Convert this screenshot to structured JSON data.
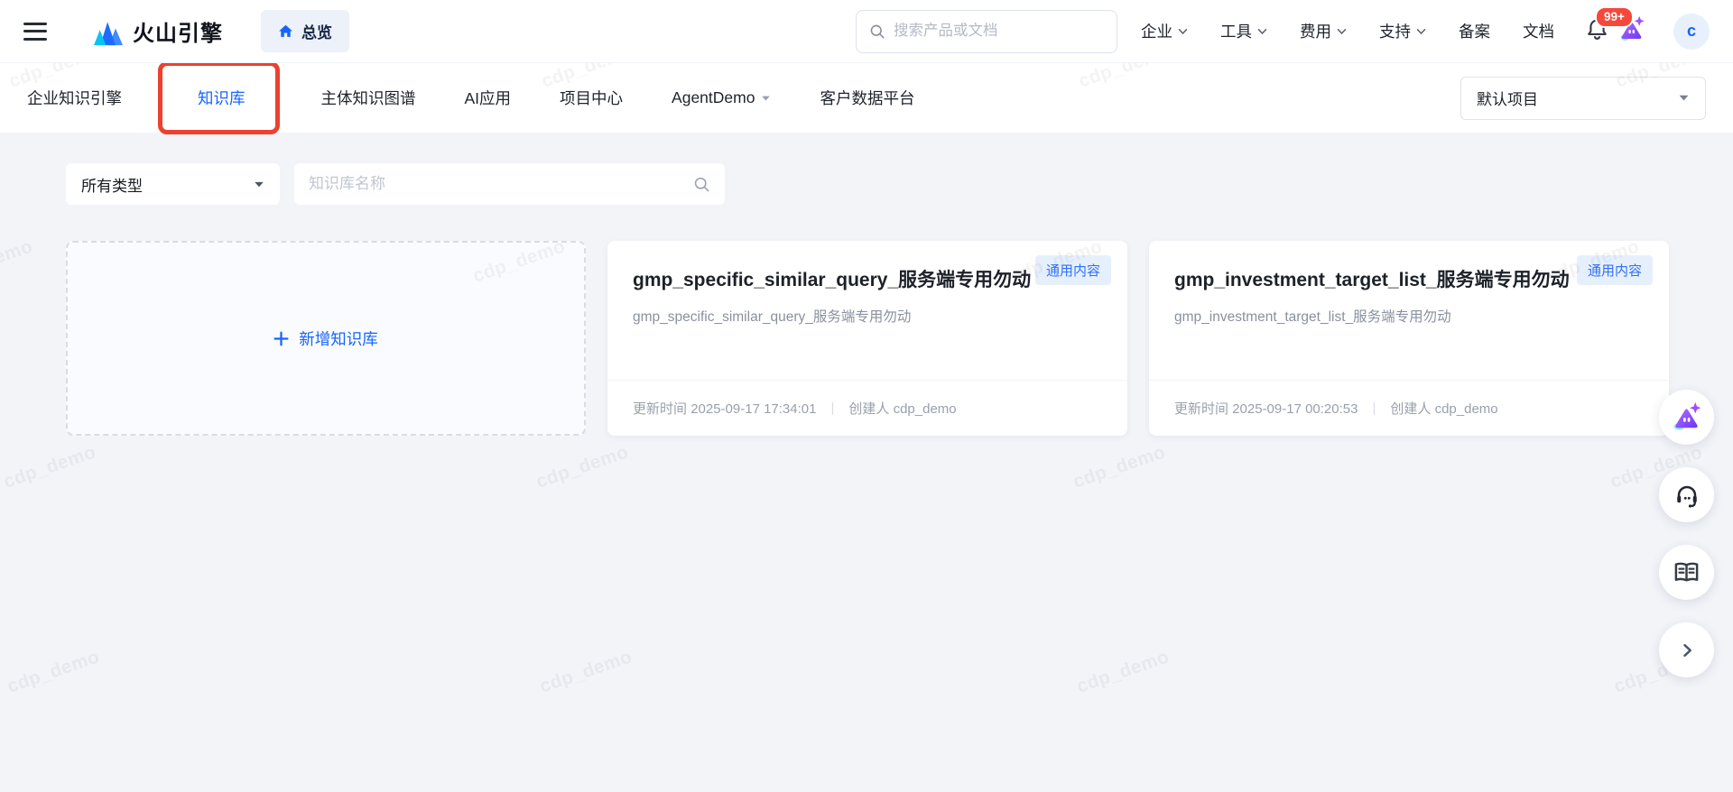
{
  "header": {
    "brand": "火山引擎",
    "overview_label": "总览",
    "search_placeholder": "搜索产品或文档",
    "nav": [
      {
        "label": "企业",
        "dropdown": true
      },
      {
        "label": "工具",
        "dropdown": true
      },
      {
        "label": "费用",
        "dropdown": true
      },
      {
        "label": "支持",
        "dropdown": true
      },
      {
        "label": "备案",
        "dropdown": false
      },
      {
        "label": "文档",
        "dropdown": false
      }
    ],
    "notification_count": "99+",
    "avatar_initial": "c"
  },
  "subnav": {
    "items": [
      {
        "label": "企业知识引擎",
        "active": false,
        "annotated": false,
        "dropdown": false
      },
      {
        "label": "知识库",
        "active": true,
        "annotated": true,
        "dropdown": false
      },
      {
        "label": "主体知识图谱",
        "active": false,
        "annotated": false,
        "dropdown": false
      },
      {
        "label": "AI应用",
        "active": false,
        "annotated": false,
        "dropdown": false
      },
      {
        "label": "项目中心",
        "active": false,
        "annotated": false,
        "dropdown": false
      },
      {
        "label": "AgentDemo",
        "active": false,
        "annotated": false,
        "dropdown": true
      },
      {
        "label": "客户数据平台",
        "active": false,
        "annotated": false,
        "dropdown": false
      }
    ],
    "project_select_value": "默认项目"
  },
  "filters": {
    "type_select_value": "所有类型",
    "name_placeholder": "知识库名称"
  },
  "cards": {
    "add_label": "新增知识库",
    "divider": "|",
    "items": [
      {
        "title": "gmp_specific_similar_query_服务端专用勿动",
        "subtitle": "gmp_specific_similar_query_服务端专用勿动",
        "badge": "通用内容",
        "updated_label": "更新时间",
        "updated_value": "2025-09-17 17:34:01",
        "creator_label": "创建人",
        "creator_value": "cdp_demo"
      },
      {
        "title": "gmp_investment_target_list_服务端专用勿动",
        "subtitle": "gmp_investment_target_list_服务端专用勿动",
        "badge": "通用内容",
        "updated_label": "更新时间",
        "updated_value": "2025-09-17 00:20:53",
        "creator_label": "创建人",
        "creator_value": "cdp_demo"
      }
    ]
  },
  "watermark_text": "cdp_demo",
  "colors": {
    "accent": "#1664ff",
    "annotation_red": "#ec4130",
    "notification_red": "#f5483b",
    "badge_bg": "#e6f0fd",
    "badge_text": "#2e6fff",
    "page_bg": "#f2f4f8"
  }
}
